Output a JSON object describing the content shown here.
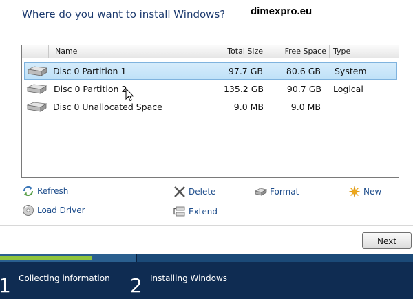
{
  "header": {
    "title": "Where do you want to install Windows?",
    "watermark": "dimexpro.eu"
  },
  "table": {
    "columns": [
      "Name",
      "Total Size",
      "Free Space",
      "Type"
    ],
    "rows": [
      {
        "name": "Disc 0 Partition 1",
        "total": "97.7 GB",
        "free": "80.6 GB",
        "type": "System",
        "selected": true
      },
      {
        "name": "Disc 0 Partition 2",
        "total": "135.2 GB",
        "free": "90.7 GB",
        "type": "Logical",
        "selected": false
      },
      {
        "name": "Disc 0 Unallocated Space",
        "total": "9.0 MB",
        "free": "9.0 MB",
        "type": "",
        "selected": false
      }
    ]
  },
  "actions": {
    "refresh": "Refresh",
    "delete": "Delete",
    "format": "Format",
    "new": "New",
    "load_driver": "Load Driver",
    "extend": "Extend"
  },
  "buttons": {
    "next": "Next"
  },
  "footer": {
    "steps": [
      {
        "num": "1",
        "label": "Collecting information"
      },
      {
        "num": "2",
        "label": "Installing Windows"
      }
    ],
    "progress": 0.68
  },
  "colors": {
    "title": "#1c3a6e",
    "selection": "#bfe1f8",
    "footer_bg": "#0f2c52",
    "progress": "#8fc43c"
  },
  "icons": [
    "disk-icon",
    "refresh-icon",
    "delete-icon",
    "format-icon",
    "new-icon",
    "load-driver-icon",
    "extend-icon",
    "mouse-cursor-icon"
  ]
}
